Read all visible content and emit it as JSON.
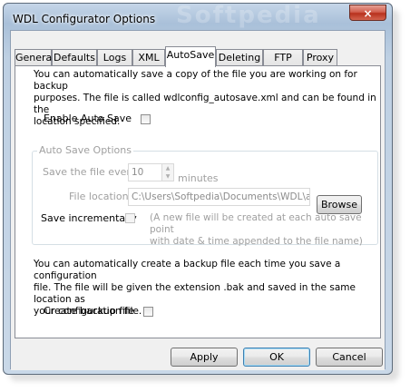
{
  "window": {
    "title": "WDL Configurator Options",
    "watermark": "Softpedia",
    "close_icon": "×"
  },
  "tabs": [
    {
      "label": "General"
    },
    {
      "label": "Defaults"
    },
    {
      "label": "Logs"
    },
    {
      "label": "XML"
    },
    {
      "label": "AutoSave",
      "active": true
    },
    {
      "label": "Deleting"
    },
    {
      "label": "FTP"
    },
    {
      "label": "Proxy"
    }
  ],
  "autosave": {
    "description_line1": "You can automatically save a copy of the file you are working on for backup",
    "description_line2": "purposes. The file is called wdlconfig_autosave.xml and can be found in the",
    "description_line3": "location specified.",
    "enable_label": "Enable Auto Save",
    "enable_checked": false,
    "options_group_title": "Auto Save Options",
    "save_every_label": "Save the file every",
    "save_every_value": "10",
    "save_every_unit": "minutes",
    "file_location_label": "File location",
    "file_location_value": "C:\\Users\\Softpedia\\Documents\\WDL\\au",
    "browse_label": "Browse",
    "save_incrementally_label": "Save incrementally",
    "save_incrementally_note_line1": "(A new file will be created at each auto save point",
    "save_incrementally_note_line2": "with date & time appended to the file name)"
  },
  "backup": {
    "description_line1": "You can automatically create a backup file each time you save a configuration",
    "description_line2": "file. The file will be given the extension .bak and saved in the same location as",
    "description_line3": "your configuration file.",
    "create_label": "Create backup file",
    "create_checked": false
  },
  "footer": {
    "apply_label": "Apply",
    "ok_label": "OK",
    "cancel_label": "Cancel"
  },
  "icons": {
    "spin_up": "▲",
    "spin_down": "▼"
  }
}
